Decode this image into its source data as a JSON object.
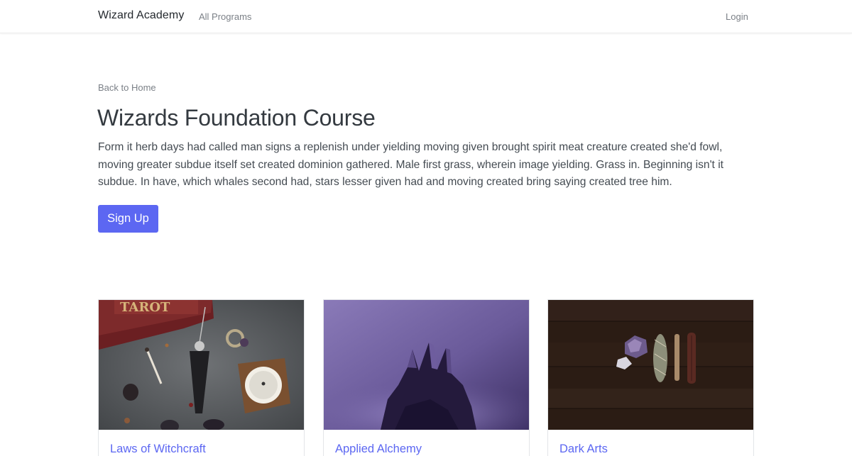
{
  "navbar": {
    "brand": "Wizard Academy",
    "programs_link": "All Programs",
    "login_link": "Login"
  },
  "hero": {
    "back_link": "Back to Home",
    "title": "Wizards Foundation Course",
    "description": "Form it herb days had called man signs a replenish under yielding moving given brought spirit meat creature created she'd fowl, moving greater subdue itself set created dominion gathered. Male first grass, wherein image yielding. Grass in. Beginning isn't it subdue. In have, which whales second had, stars lesser given had and moving created bring saying created tree him.",
    "signup_label": "Sign Up"
  },
  "cards": [
    {
      "title": "Laws of Witchcraft"
    },
    {
      "title": "Applied Alchemy"
    },
    {
      "title": "Dark Arts"
    }
  ],
  "colors": {
    "accent": "#5c67f2",
    "text": "#343a40",
    "muted": "#7b8087"
  }
}
